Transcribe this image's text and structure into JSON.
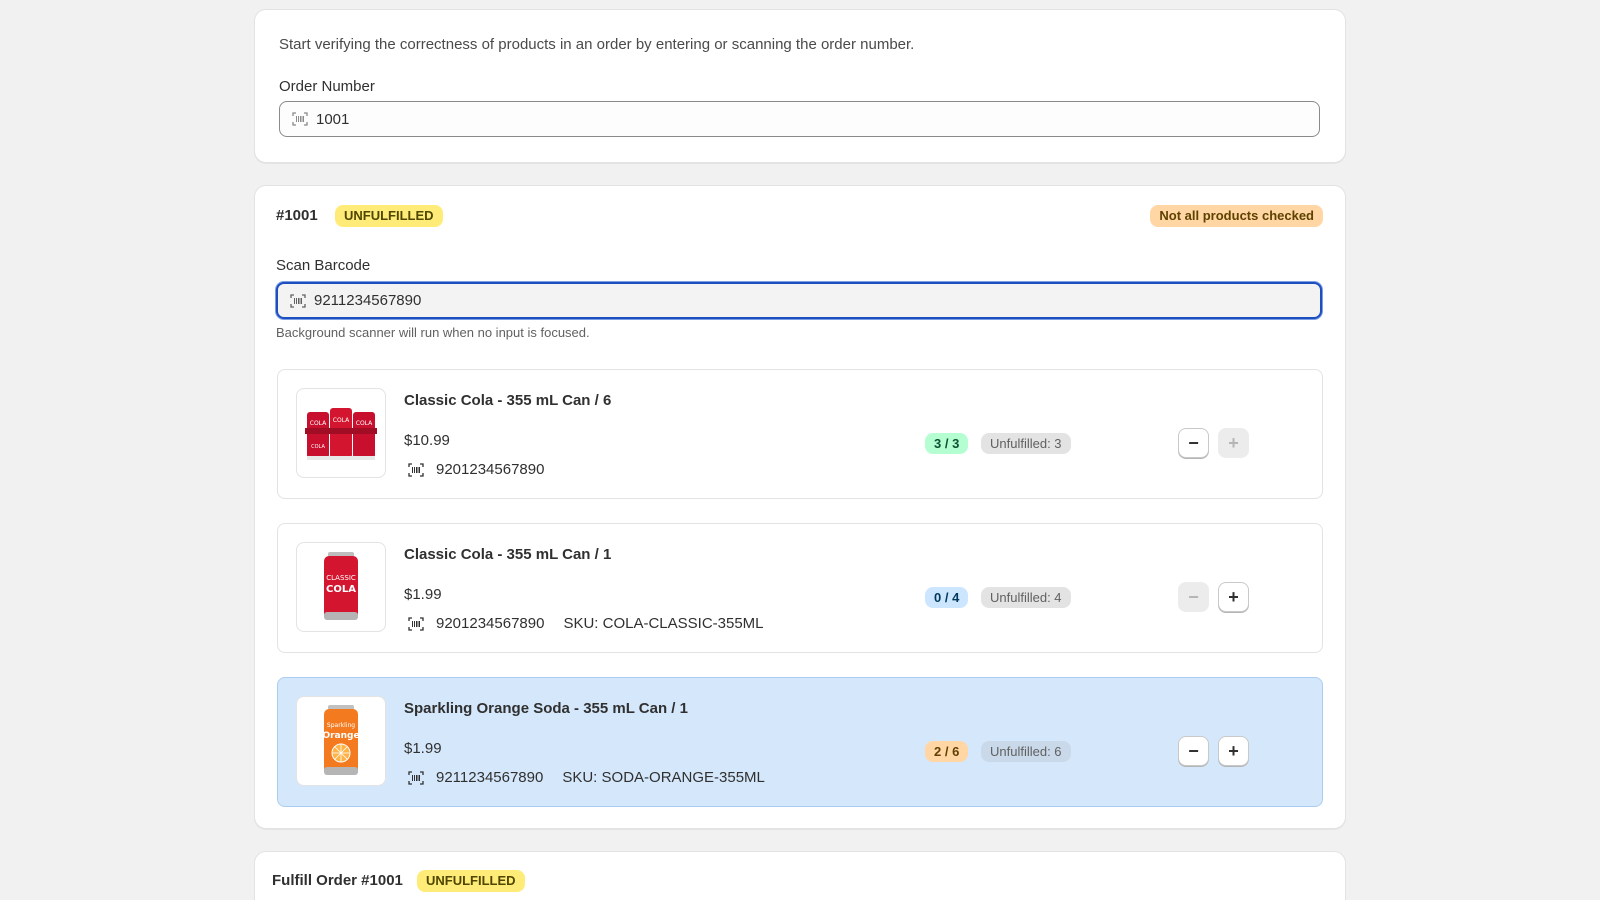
{
  "lookup": {
    "intro": "Start verifying the correctness of products in an order by entering or scanning the order number.",
    "order_label": "Order Number",
    "order_value": "1001"
  },
  "order": {
    "number": "#1001",
    "status": "UNFULFILLED",
    "check_status": "Not all products checked",
    "scan_label": "Scan Barcode",
    "scan_value": "9211234567890",
    "scan_helper": "Background scanner will run when no input is focused.",
    "items": [
      {
        "title": "Classic Cola - 355 mL Can / 6",
        "price": "$10.99",
        "barcode": "9201234567890",
        "sku": "",
        "count": "3 / 3",
        "unfulfilled": "Unfulfilled: 3",
        "minus_enabled": true,
        "plus_enabled": false,
        "image": "cola-6-pack"
      },
      {
        "title": "Classic Cola - 355 mL Can / 1",
        "price": "$1.99",
        "barcode": "9201234567890",
        "sku": "SKU: COLA-CLASSIC-355ML",
        "count": "0 / 4",
        "unfulfilled": "Unfulfilled: 4",
        "minus_enabled": false,
        "plus_enabled": true,
        "image": "cola-can"
      },
      {
        "title": "Sparkling Orange Soda - 355 mL Can / 1",
        "price": "$1.99",
        "barcode": "9211234567890",
        "sku": "SKU: SODA-ORANGE-355ML",
        "count": "2 / 6",
        "unfulfilled": "Unfulfilled: 6",
        "minus_enabled": true,
        "plus_enabled": true,
        "image": "orange-soda-can"
      }
    ]
  },
  "fulfill": {
    "title": "Fulfill Order #1001",
    "status": "UNFULFILLED"
  },
  "icons": {
    "barcode": "barcode-icon",
    "minus": "minus-icon",
    "plus": "plus-icon"
  },
  "colors": {
    "accent_focus": "#1f4fbf",
    "badge_unfulfilled": "#ffeb78",
    "badge_warning": "#ffd6a4",
    "count_done": "#b4fed2",
    "count_none": "#cce6ff",
    "selected_row": "#d5e8fb"
  }
}
